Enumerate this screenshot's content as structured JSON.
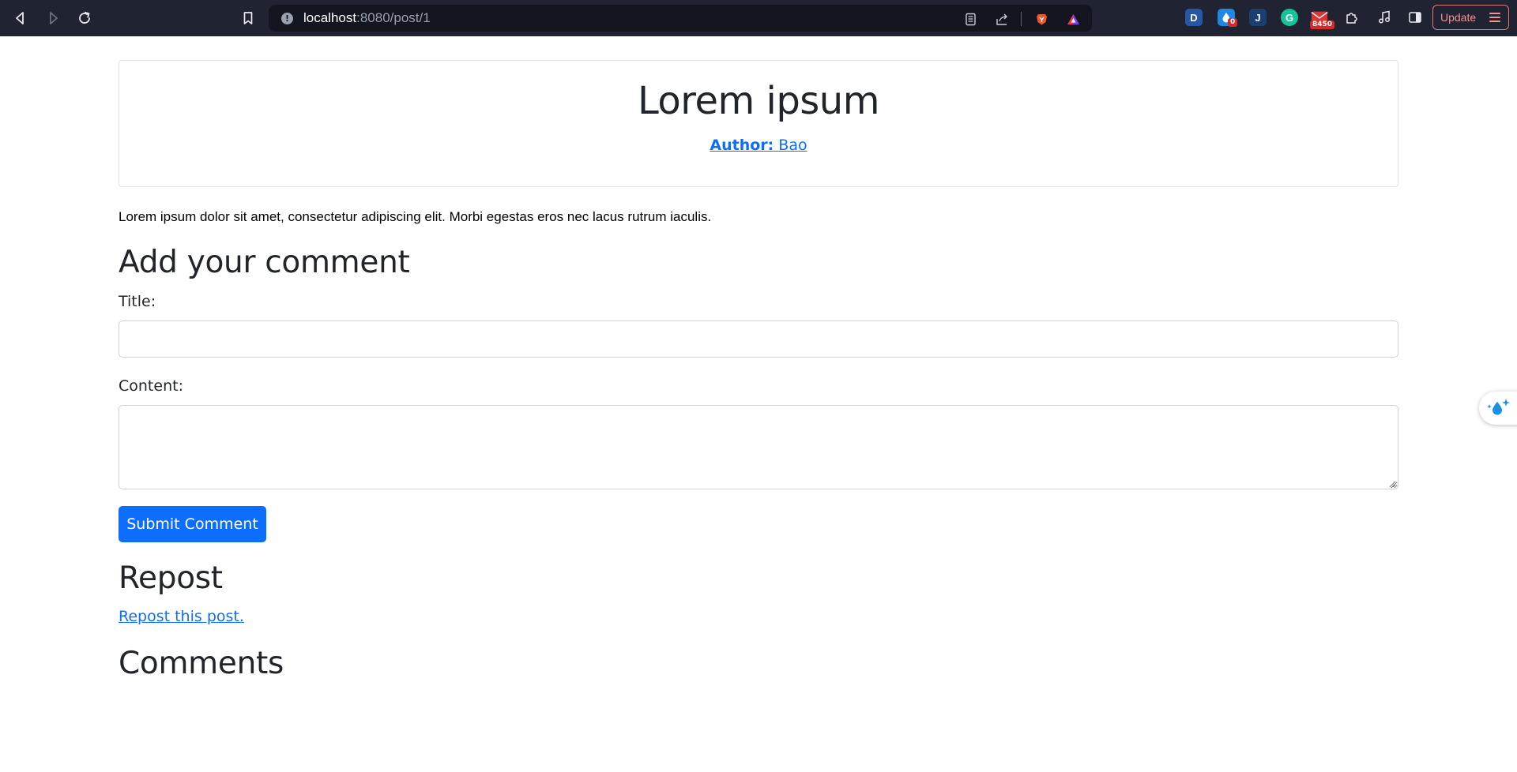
{
  "browser": {
    "url_host": "localhost",
    "url_path": ":8080/post/1",
    "update_label": "Update",
    "extensions": [
      {
        "name": "dashlane-extension",
        "letter": "D",
        "color": "#2856a6"
      },
      {
        "name": "raindrop-extension",
        "badge": "0",
        "color": "#1e88e5"
      },
      {
        "name": "jstor-extension",
        "letter": "J",
        "color": "#1c3f72"
      },
      {
        "name": "grammarly-extension",
        "letter": "G",
        "color": "#15c39a"
      },
      {
        "name": "mail-extension",
        "badge": "8450",
        "color": "#d93636"
      }
    ]
  },
  "post": {
    "title": "Lorem ipsum",
    "author_label": "Author:",
    "author_name": "Bao",
    "body": "Lorem ipsum dolor sit amet, consectetur adipiscing elit. Morbi egestas eros nec lacus rutrum iaculis."
  },
  "comment_form": {
    "heading": "Add your comment",
    "title_label": "Title:",
    "title_value": "",
    "content_label": "Content:",
    "content_value": "",
    "submit_label": "Submit Comment"
  },
  "repost": {
    "heading": "Repost",
    "link_text": "Repost this post."
  },
  "comments": {
    "heading": "Comments"
  }
}
